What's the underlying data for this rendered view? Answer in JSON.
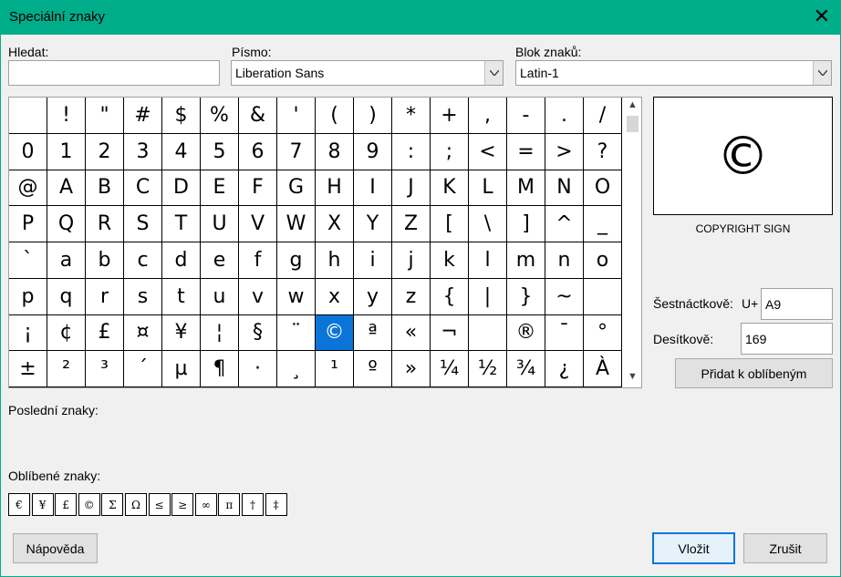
{
  "window": {
    "title": "Speciální znaky"
  },
  "search": {
    "label": "Hledat:",
    "value": ""
  },
  "font": {
    "label": "Písmo:",
    "value": "Liberation Sans"
  },
  "block": {
    "label": "Blok znaků:",
    "value": "Latin-1"
  },
  "grid": {
    "selected_index": 104,
    "cells": [
      "",
      "!",
      "\"",
      "#",
      "$",
      "%",
      "&",
      "'",
      "(",
      ")",
      "*",
      "+",
      ",",
      "-",
      ".",
      "/",
      "0",
      "1",
      "2",
      "3",
      "4",
      "5",
      "6",
      "7",
      "8",
      "9",
      ":",
      ";",
      "<",
      "=",
      ">",
      "?",
      "@",
      "A",
      "B",
      "C",
      "D",
      "E",
      "F",
      "G",
      "H",
      "I",
      "J",
      "K",
      "L",
      "M",
      "N",
      "O",
      "P",
      "Q",
      "R",
      "S",
      "T",
      "U",
      "V",
      "W",
      "X",
      "Y",
      "Z",
      "[",
      "\\",
      "]",
      "^",
      "_",
      "`",
      "a",
      "b",
      "c",
      "d",
      "e",
      "f",
      "g",
      "h",
      "i",
      "j",
      "k",
      "l",
      "m",
      "n",
      "o",
      "p",
      "q",
      "r",
      "s",
      "t",
      "u",
      "v",
      "w",
      "x",
      "y",
      "z",
      "{",
      "|",
      "}",
      "~",
      "",
      "¡",
      "¢",
      "£",
      "¤",
      "¥",
      "¦",
      "§",
      "¨",
      "©",
      "ª",
      "«",
      "¬",
      "",
      "®",
      "¯",
      "°",
      "±",
      "²",
      "³",
      "´",
      "µ",
      "¶",
      "·",
      "¸",
      "¹",
      "º",
      "»",
      "¼",
      "½",
      "¾",
      "¿",
      "À"
    ]
  },
  "preview": {
    "char": "©",
    "name": "COPYRIGHT SIGN"
  },
  "hex": {
    "label": "Šestnáctkově:",
    "prefix": "U+",
    "value": "A9"
  },
  "decimal": {
    "label": "Desítkově:",
    "value": "169"
  },
  "add_favorite_label": "Přidat k oblíbeným",
  "recent": {
    "label": "Poslední znaky:"
  },
  "favorites": {
    "label": "Oblíbené znaky:",
    "chars": [
      "€",
      "¥",
      "£",
      "©",
      "Σ",
      "Ω",
      "≤",
      "≥",
      "∞",
      "π",
      "†",
      "‡"
    ]
  },
  "buttons": {
    "help": "Nápověda",
    "insert": "Vložit",
    "cancel": "Zrušit"
  },
  "icons": {
    "close": "close-icon",
    "dropdown": "chevron-down-icon"
  },
  "colors": {
    "titlebar": "#00ad8a",
    "selection": "#0a74d9",
    "default_button_border": "#0078d7"
  }
}
